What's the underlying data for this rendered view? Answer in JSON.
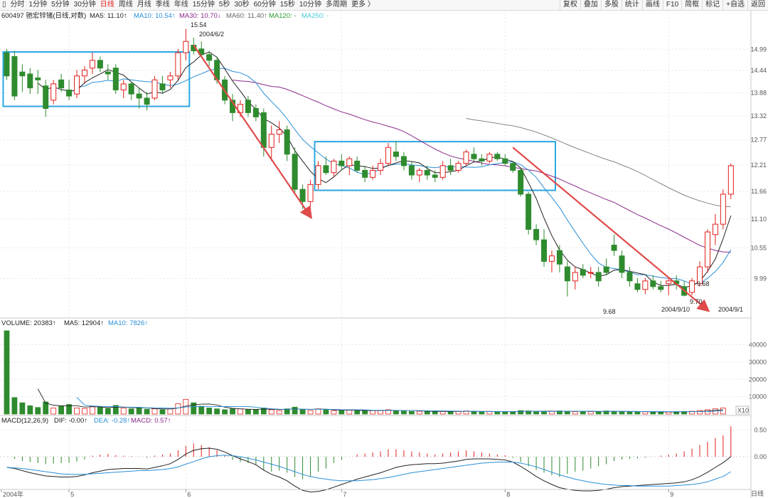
{
  "toolbar": {
    "periods": [
      "分时",
      "1分钟",
      "5分钟",
      "30分钟",
      "日线",
      "周线",
      "月线",
      "季线",
      "年线",
      "15分钟",
      "5秒",
      "30秒",
      "60分钟",
      "15秒",
      "10分钟",
      "多周期",
      "更多 〉"
    ],
    "active_period": "日线",
    "tools": [
      "复权",
      "叠加",
      "多股",
      "统计",
      "画线",
      "F10",
      "简框",
      "标记",
      "+自选",
      "返回"
    ]
  },
  "colors": {
    "up": "#e0201c",
    "down": "#2e8b2e",
    "ma5": "#222222",
    "ma10": "#2a8fd6",
    "ma30": "#8b2a8b",
    "ma60": "#777777",
    "ma120": "#2e9a2e",
    "ma250": "#44c9d4",
    "box": "#2aa8e0",
    "arrow": "#e04a4a"
  },
  "chart_data": {
    "type": "candlestick",
    "stock_label": "600497 驰宏锌锗(日线,对数)",
    "ma_labels": [
      {
        "name": "MA5",
        "value": "11.10↑"
      },
      {
        "name": "MA10",
        "value": "10.54↑"
      },
      {
        "name": "MA30",
        "value": "10.70↓"
      },
      {
        "name": "MA60",
        "value": "11.40↑"
      },
      {
        "name": "MA120",
        "value": "-"
      },
      {
        "name": "MA250",
        "value": "-"
      }
    ],
    "price_ticks": [
      14.99,
      14.44,
      13.88,
      13.32,
      12.77,
      12.21,
      11.66,
      11.1,
      10.55,
      9.99
    ],
    "y_range": [
      9.4,
      15.75
    ],
    "volume_label": "VOLUME: 20383↑",
    "volume_ma": [
      "MA5: 12904↑",
      "MA10: 7826↑"
    ],
    "volume_ticks": [
      40000,
      30000,
      20000,
      10000
    ],
    "volume_unit": "X10",
    "volume_max": 48000,
    "macd_label": "MACD(12,26,9)",
    "macd_values": [
      "DIF: -0.00↑",
      "DEA: -0.28↑",
      "MACD: 0.57↑"
    ],
    "macd_ticks": [
      "0.50",
      "0.00"
    ],
    "x_labels": [
      {
        "label": "2004年",
        "index": 0
      },
      {
        "label": "5",
        "index": 8
      },
      {
        "label": "6",
        "index": 23
      },
      {
        "label": "7",
        "index": 43
      },
      {
        "label": "8",
        "index": 64
      },
      {
        "label": "9",
        "index": 85
      }
    ],
    "bottom_right_label": "日线",
    "candles": [
      {
        "o": 14.9,
        "h": 15.0,
        "l": 14.2,
        "c": 14.3
      },
      {
        "o": 14.8,
        "h": 14.95,
        "l": 13.7,
        "c": 13.8
      },
      {
        "o": 14.4,
        "h": 14.6,
        "l": 13.9,
        "c": 14.3
      },
      {
        "o": 14.35,
        "h": 14.5,
        "l": 13.85,
        "c": 14.0
      },
      {
        "o": 14.25,
        "h": 14.45,
        "l": 13.85,
        "c": 14.2
      },
      {
        "o": 14.05,
        "h": 14.2,
        "l": 13.3,
        "c": 13.5
      },
      {
        "o": 13.7,
        "h": 14.2,
        "l": 13.6,
        "c": 14.1
      },
      {
        "o": 14.2,
        "h": 14.35,
        "l": 13.9,
        "c": 14.0
      },
      {
        "o": 13.95,
        "h": 14.2,
        "l": 13.7,
        "c": 13.8
      },
      {
        "o": 13.85,
        "h": 14.45,
        "l": 13.75,
        "c": 14.3
      },
      {
        "o": 14.3,
        "h": 14.55,
        "l": 14.1,
        "c": 14.45
      },
      {
        "o": 14.5,
        "h": 14.9,
        "l": 14.35,
        "c": 14.7
      },
      {
        "o": 14.7,
        "h": 14.8,
        "l": 14.4,
        "c": 14.5
      },
      {
        "o": 14.4,
        "h": 14.6,
        "l": 14.2,
        "c": 14.35
      },
      {
        "o": 14.5,
        "h": 14.6,
        "l": 13.85,
        "c": 13.95
      },
      {
        "o": 13.95,
        "h": 14.2,
        "l": 13.75,
        "c": 14.1
      },
      {
        "o": 14.1,
        "h": 14.15,
        "l": 13.7,
        "c": 13.85
      },
      {
        "o": 13.85,
        "h": 14.0,
        "l": 13.5,
        "c": 13.75
      },
      {
        "o": 13.75,
        "h": 13.9,
        "l": 13.45,
        "c": 13.6
      },
      {
        "o": 13.75,
        "h": 14.3,
        "l": 13.7,
        "c": 14.2
      },
      {
        "o": 14.1,
        "h": 14.3,
        "l": 13.85,
        "c": 13.95
      },
      {
        "o": 14.2,
        "h": 14.4,
        "l": 14.0,
        "c": 14.3
      },
      {
        "o": 14.3,
        "h": 15.0,
        "l": 14.2,
        "c": 14.9
      },
      {
        "o": 14.9,
        "h": 15.54,
        "l": 14.7,
        "c": 15.2
      },
      {
        "o": 15.1,
        "h": 15.3,
        "l": 14.85,
        "c": 14.95
      },
      {
        "o": 15.0,
        "h": 15.2,
        "l": 14.8,
        "c": 14.85
      },
      {
        "o": 14.85,
        "h": 14.95,
        "l": 14.55,
        "c": 14.7
      },
      {
        "o": 14.7,
        "h": 14.8,
        "l": 14.1,
        "c": 14.2
      },
      {
        "o": 14.2,
        "h": 14.3,
        "l": 13.6,
        "c": 13.7
      },
      {
        "o": 13.7,
        "h": 13.85,
        "l": 13.2,
        "c": 13.4
      },
      {
        "o": 13.4,
        "h": 13.7,
        "l": 13.3,
        "c": 13.6
      },
      {
        "o": 13.7,
        "h": 13.8,
        "l": 13.3,
        "c": 13.4
      },
      {
        "o": 13.5,
        "h": 13.6,
        "l": 13.2,
        "c": 13.3
      },
      {
        "o": 13.4,
        "h": 13.5,
        "l": 12.4,
        "c": 12.6
      },
      {
        "o": 12.6,
        "h": 13.1,
        "l": 12.3,
        "c": 12.9
      },
      {
        "o": 12.9,
        "h": 13.2,
        "l": 12.7,
        "c": 13.0
      },
      {
        "o": 13.0,
        "h": 13.1,
        "l": 12.3,
        "c": 12.45
      },
      {
        "o": 12.45,
        "h": 12.6,
        "l": 11.6,
        "c": 11.7
      },
      {
        "o": 11.7,
        "h": 11.8,
        "l": 11.3,
        "c": 11.45
      },
      {
        "o": 11.45,
        "h": 11.9,
        "l": 11.35,
        "c": 11.8
      },
      {
        "o": 11.8,
        "h": 12.3,
        "l": 11.7,
        "c": 12.2
      },
      {
        "o": 12.2,
        "h": 12.4,
        "l": 12.0,
        "c": 12.05
      },
      {
        "o": 12.05,
        "h": 12.35,
        "l": 11.95,
        "c": 12.3
      },
      {
        "o": 12.3,
        "h": 12.45,
        "l": 12.1,
        "c": 12.2
      },
      {
        "o": 12.2,
        "h": 12.4,
        "l": 12.0,
        "c": 12.35
      },
      {
        "o": 12.3,
        "h": 12.4,
        "l": 12.05,
        "c": 12.1
      },
      {
        "o": 12.1,
        "h": 12.2,
        "l": 11.85,
        "c": 11.95
      },
      {
        "o": 11.95,
        "h": 12.2,
        "l": 11.9,
        "c": 12.1
      },
      {
        "o": 12.1,
        "h": 12.35,
        "l": 12.0,
        "c": 12.25
      },
      {
        "o": 12.25,
        "h": 12.7,
        "l": 12.2,
        "c": 12.6
      },
      {
        "o": 12.5,
        "h": 12.75,
        "l": 12.3,
        "c": 12.4
      },
      {
        "o": 12.4,
        "h": 12.5,
        "l": 12.1,
        "c": 12.2
      },
      {
        "o": 12.2,
        "h": 12.3,
        "l": 11.9,
        "c": 12.0
      },
      {
        "o": 12.0,
        "h": 12.15,
        "l": 11.85,
        "c": 12.1
      },
      {
        "o": 12.1,
        "h": 12.2,
        "l": 11.9,
        "c": 12.0
      },
      {
        "o": 12.0,
        "h": 12.1,
        "l": 11.85,
        "c": 11.95
      },
      {
        "o": 11.95,
        "h": 12.3,
        "l": 11.9,
        "c": 12.2
      },
      {
        "o": 12.2,
        "h": 12.35,
        "l": 12.0,
        "c": 12.1
      },
      {
        "o": 12.1,
        "h": 12.3,
        "l": 12.05,
        "c": 12.25
      },
      {
        "o": 12.25,
        "h": 12.55,
        "l": 12.2,
        "c": 12.5
      },
      {
        "o": 12.45,
        "h": 12.6,
        "l": 12.3,
        "c": 12.35
      },
      {
        "o": 12.35,
        "h": 12.45,
        "l": 12.2,
        "c": 12.3
      },
      {
        "o": 12.3,
        "h": 12.5,
        "l": 12.25,
        "c": 12.45
      },
      {
        "o": 12.45,
        "h": 12.5,
        "l": 12.3,
        "c": 12.35
      },
      {
        "o": 12.35,
        "h": 12.45,
        "l": 12.2,
        "c": 12.25
      },
      {
        "o": 12.25,
        "h": 12.3,
        "l": 12.05,
        "c": 12.1
      },
      {
        "o": 12.1,
        "h": 12.15,
        "l": 11.55,
        "c": 11.6
      },
      {
        "o": 11.6,
        "h": 11.65,
        "l": 10.8,
        "c": 10.9
      },
      {
        "o": 10.9,
        "h": 11.0,
        "l": 10.6,
        "c": 10.7
      },
      {
        "o": 10.7,
        "h": 10.9,
        "l": 10.2,
        "c": 10.3
      },
      {
        "o": 10.3,
        "h": 10.5,
        "l": 10.1,
        "c": 10.4
      },
      {
        "o": 10.5,
        "h": 10.6,
        "l": 10.1,
        "c": 10.25
      },
      {
        "o": 10.2,
        "h": 10.3,
        "l": 9.68,
        "c": 9.95
      },
      {
        "o": 9.95,
        "h": 10.2,
        "l": 9.8,
        "c": 10.1
      },
      {
        "o": 10.15,
        "h": 10.25,
        "l": 10.0,
        "c": 10.05
      },
      {
        "o": 10.1,
        "h": 10.2,
        "l": 10.0,
        "c": 10.1
      },
      {
        "o": 10.1,
        "h": 10.2,
        "l": 9.85,
        "c": 9.95
      },
      {
        "o": 10.2,
        "h": 10.35,
        "l": 10.05,
        "c": 10.1
      },
      {
        "o": 10.6,
        "h": 10.8,
        "l": 10.4,
        "c": 10.5
      },
      {
        "o": 10.4,
        "h": 10.5,
        "l": 10.0,
        "c": 10.1
      },
      {
        "o": 10.1,
        "h": 10.2,
        "l": 9.85,
        "c": 9.95
      },
      {
        "o": 9.9,
        "h": 10.0,
        "l": 9.75,
        "c": 9.8
      },
      {
        "o": 9.8,
        "h": 10.0,
        "l": 9.72,
        "c": 9.95
      },
      {
        "o": 9.95,
        "h": 10.05,
        "l": 9.8,
        "c": 9.85
      },
      {
        "o": 9.85,
        "h": 9.95,
        "l": 9.75,
        "c": 9.8
      },
      {
        "o": 9.9,
        "h": 10.0,
        "l": 9.7,
        "c": 9.95
      },
      {
        "o": 9.95,
        "h": 10.05,
        "l": 9.8,
        "c": 9.9
      },
      {
        "o": 9.85,
        "h": 9.95,
        "l": 9.68,
        "c": 9.7
      },
      {
        "o": 9.75,
        "h": 10.0,
        "l": 9.7,
        "c": 9.95
      },
      {
        "o": 9.9,
        "h": 10.3,
        "l": 9.85,
        "c": 10.2
      },
      {
        "o": 10.2,
        "h": 10.9,
        "l": 10.1,
        "c": 10.85
      },
      {
        "o": 10.8,
        "h": 11.2,
        "l": 10.6,
        "c": 11.0
      },
      {
        "o": 11.0,
        "h": 11.7,
        "l": 10.9,
        "c": 11.6
      },
      {
        "o": 11.6,
        "h": 12.25,
        "l": 11.5,
        "c": 12.2
      }
    ],
    "volumes": [
      48000,
      9500,
      6500,
      4800,
      3800,
      7000,
      3500,
      4500,
      5500,
      3500,
      3200,
      4500,
      4000,
      3200,
      5000,
      3500,
      3000,
      3500,
      2800,
      3000,
      2500,
      3000,
      6000,
      8500,
      6500,
      4500,
      3500,
      3000,
      2500,
      3000,
      3000,
      2500,
      2500,
      3500,
      2500,
      2000,
      3000,
      4000,
      2500,
      2000,
      3000,
      2500,
      2000,
      2000,
      2200,
      2000,
      1800,
      2000,
      2200,
      2500,
      2000,
      1800,
      1500,
      1600,
      1500,
      1400,
      1600,
      1500,
      1500,
      1800,
      1500,
      1300,
      1400,
      1400,
      1300,
      1500,
      2000,
      1800,
      1500,
      1400,
      1500,
      1800,
      1600,
      1400,
      1500,
      1400,
      1500,
      1800,
      1600,
      1400,
      1300,
      1400,
      1300,
      1200,
      1300,
      1200,
      1300,
      1500,
      1600,
      2000,
      2500,
      3000,
      3500
    ],
    "macd_hist": [
      0.0,
      -0.04,
      -0.08,
      -0.1,
      -0.12,
      -0.14,
      -0.13,
      -0.12,
      -0.11,
      -0.09,
      -0.05,
      0.02,
      0.04,
      0.05,
      0.03,
      0.02,
      0.01,
      0.0,
      -0.02,
      0.02,
      0.04,
      0.06,
      0.12,
      0.2,
      0.25,
      0.22,
      0.18,
      0.12,
      0.02,
      -0.06,
      -0.1,
      -0.12,
      -0.15,
      -0.25,
      -0.28,
      -0.26,
      -0.3,
      -0.38,
      -0.42,
      -0.38,
      -0.28,
      -0.22,
      -0.12,
      -0.06,
      0.0,
      0.04,
      0.06,
      0.08,
      0.1,
      0.14,
      0.14,
      0.12,
      0.1,
      0.08,
      0.06,
      0.04,
      0.06,
      0.08,
      0.1,
      0.12,
      0.1,
      0.08,
      0.06,
      0.04,
      0.03,
      -0.02,
      -0.1,
      -0.18,
      -0.25,
      -0.3,
      -0.35,
      -0.38,
      -0.32,
      -0.28,
      -0.26,
      -0.22,
      -0.18,
      -0.14,
      -0.08,
      -0.05,
      -0.04,
      -0.03,
      -0.02,
      0.0,
      0.02,
      0.04,
      0.06,
      0.1,
      0.15,
      0.22,
      0.28,
      0.35,
      0.4,
      0.57
    ],
    "dif": [
      -0.2,
      -0.22,
      -0.26,
      -0.3,
      -0.33,
      -0.36,
      -0.37,
      -0.38,
      -0.38,
      -0.37,
      -0.34,
      -0.3,
      -0.27,
      -0.24,
      -0.23,
      -0.22,
      -0.22,
      -0.22,
      -0.23,
      -0.2,
      -0.17,
      -0.13,
      -0.05,
      0.05,
      0.12,
      0.15,
      0.16,
      0.14,
      0.09,
      0.02,
      -0.04,
      -0.09,
      -0.15,
      -0.25,
      -0.33,
      -0.38,
      -0.45,
      -0.55,
      -0.63,
      -0.66,
      -0.65,
      -0.62,
      -0.57,
      -0.52,
      -0.47,
      -0.42,
      -0.38,
      -0.34,
      -0.3,
      -0.25,
      -0.2,
      -0.17,
      -0.15,
      -0.14,
      -0.13,
      -0.13,
      -0.12,
      -0.1,
      -0.08,
      -0.05,
      -0.04,
      -0.04,
      -0.04,
      -0.05,
      -0.06,
      -0.1,
      -0.18,
      -0.27,
      -0.37,
      -0.45,
      -0.52,
      -0.58,
      -0.61,
      -0.63,
      -0.64,
      -0.64,
      -0.63,
      -0.61,
      -0.58,
      -0.56,
      -0.55,
      -0.54,
      -0.53,
      -0.52,
      -0.51,
      -0.5,
      -0.49,
      -0.47,
      -0.43,
      -0.37,
      -0.29,
      -0.2,
      -0.11,
      0.0
    ],
    "dea": [
      -0.2,
      -0.21,
      -0.22,
      -0.24,
      -0.26,
      -0.28,
      -0.3,
      -0.32,
      -0.33,
      -0.33,
      -0.33,
      -0.32,
      -0.31,
      -0.3,
      -0.29,
      -0.28,
      -0.27,
      -0.26,
      -0.26,
      -0.25,
      -0.24,
      -0.22,
      -0.19,
      -0.14,
      -0.09,
      -0.04,
      0.0,
      0.02,
      0.03,
      0.02,
      0.0,
      -0.03,
      -0.06,
      -0.1,
      -0.14,
      -0.18,
      -0.23,
      -0.28,
      -0.33,
      -0.37,
      -0.4,
      -0.42,
      -0.44,
      -0.45,
      -0.45,
      -0.45,
      -0.44,
      -0.43,
      -0.41,
      -0.39,
      -0.36,
      -0.33,
      -0.3,
      -0.28,
      -0.26,
      -0.24,
      -0.22,
      -0.2,
      -0.18,
      -0.16,
      -0.14,
      -0.12,
      -0.11,
      -0.1,
      -0.1,
      -0.1,
      -0.12,
      -0.15,
      -0.19,
      -0.24,
      -0.29,
      -0.34,
      -0.38,
      -0.42,
      -0.45,
      -0.48,
      -0.5,
      -0.52,
      -0.53,
      -0.54,
      -0.54,
      -0.55,
      -0.55,
      -0.55,
      -0.55,
      -0.55,
      -0.54,
      -0.53,
      -0.52,
      -0.5,
      -0.47,
      -0.42,
      -0.37,
      -0.28
    ]
  },
  "annotations": {
    "peak_value": "15.54",
    "peak_date": "2004/6/2",
    "low1_value": "9.68",
    "low2_value": "9.68",
    "low3_value": "9.70",
    "low3_date": "2004/9/10",
    "last_date": "2004/9/1"
  }
}
